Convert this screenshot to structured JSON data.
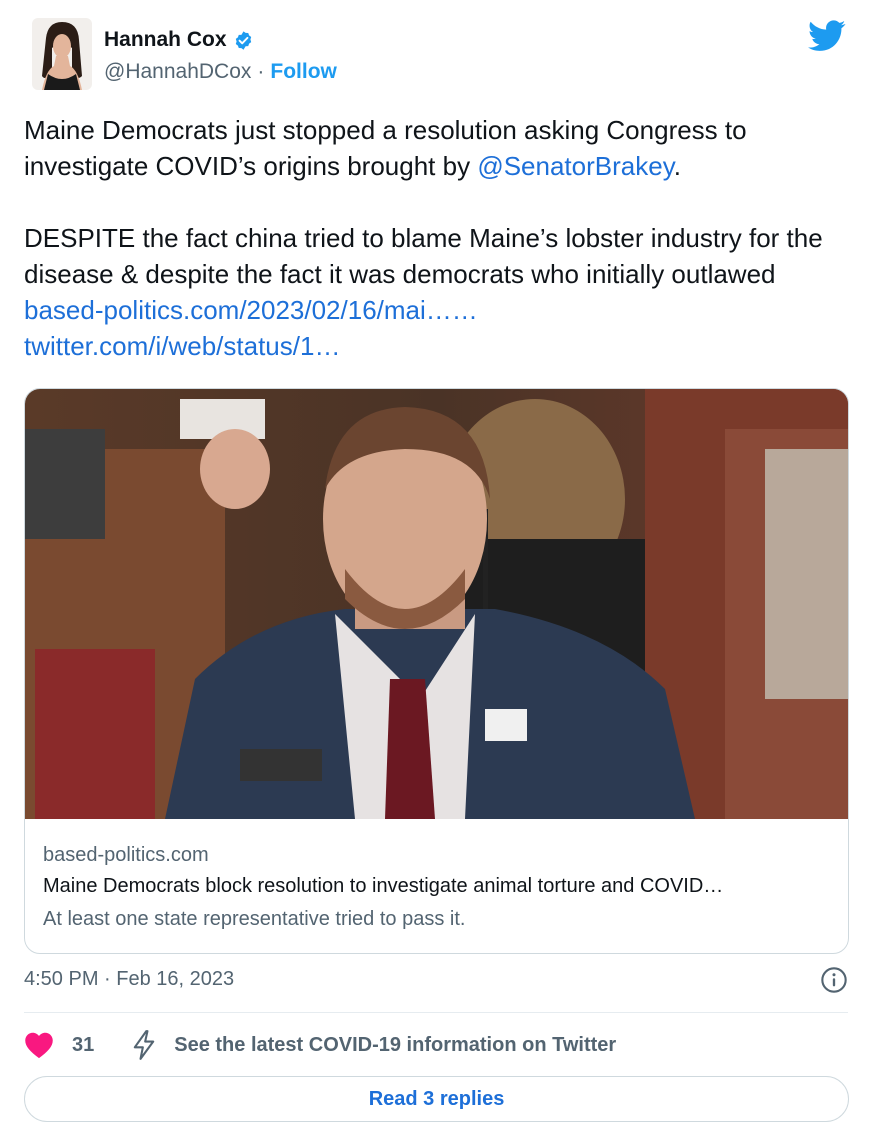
{
  "author": {
    "display_name": "Hannah Cox",
    "handle": "@HannahDCox",
    "separator": "·",
    "follow_label": "Follow"
  },
  "tweet": {
    "line1_text": "Maine Democrats just stopped a resolution asking Congress to investigate COVID’s origins brought by ",
    "mention": "@SenatorBrakey",
    "line1_end": ".",
    "para2_text": "DESPITE the fact china tried to blame Maine’s lobster industry for the disease & despite the fact it was democrats who initially outlawed ",
    "link1": "based-politics.com/2023/02/16/mai…",
    "link1_suffix": "…",
    "link2": "twitter.com/i/web/status/1…"
  },
  "media_card": {
    "domain": "based-politics.com",
    "title": "Maine Democrats block resolution to investigate animal torture and COVID…",
    "description": "At least one state representative tried to pass it."
  },
  "meta": {
    "time": "4:50 PM",
    "separator": "·",
    "date": "Feb 16, 2023"
  },
  "actions": {
    "like_count": "31",
    "covid_label": "See the latest COVID-19 information on Twitter"
  },
  "replies": {
    "label": "Read 3 replies"
  },
  "colors": {
    "link": "#1d6fd8",
    "heart": "#f91880",
    "twitter_blue": "#1d9bf0",
    "muted": "#536471"
  },
  "icons": {
    "verified": "verified-badge-icon",
    "twitter": "twitter-bird-icon",
    "info": "info-icon",
    "heart": "heart-icon",
    "bolt": "lightning-bolt-icon"
  }
}
